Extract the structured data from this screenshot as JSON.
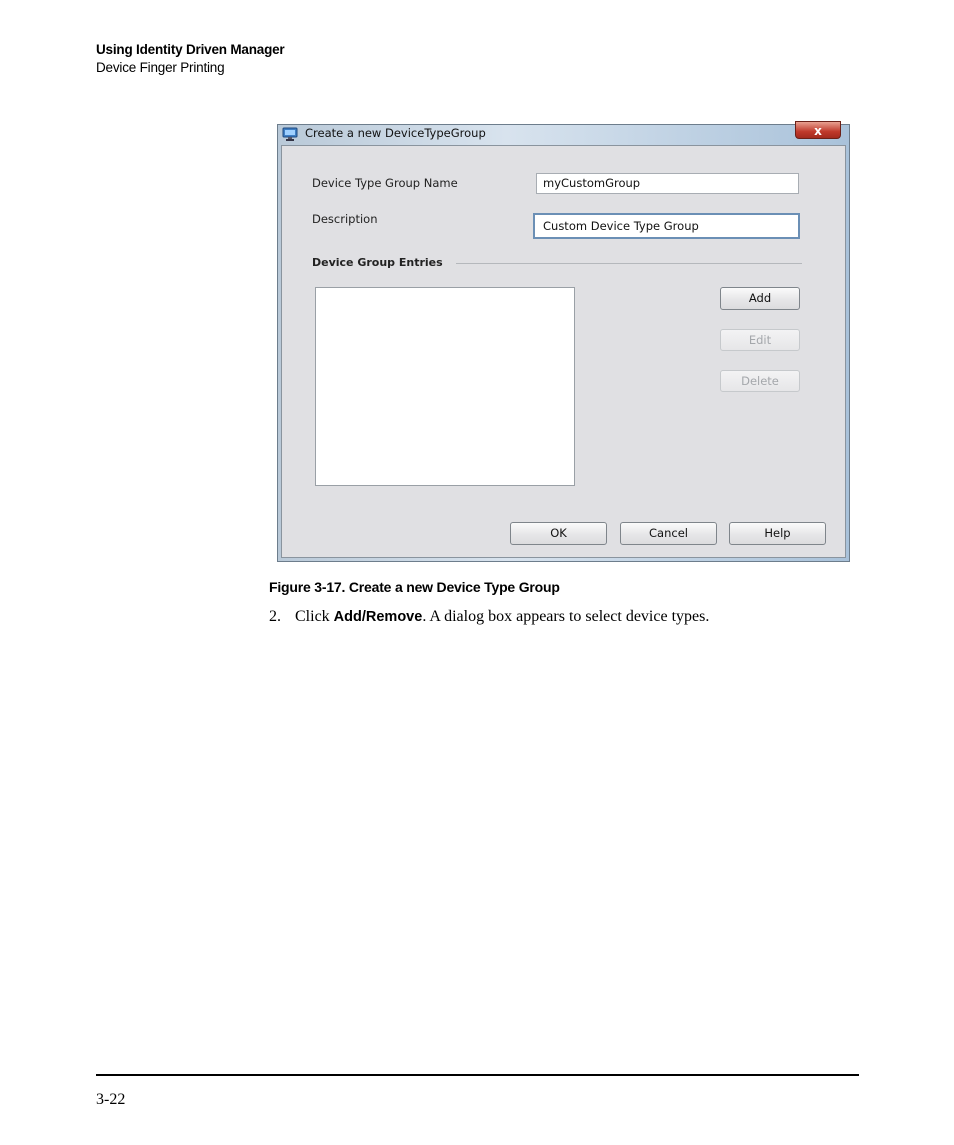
{
  "header": {
    "title": "Using Identity Driven Manager",
    "subtitle": "Device Finger Printing"
  },
  "dialog": {
    "title": "Create a new DeviceTypeGroup",
    "close_label": "x",
    "name_label": "Device Type Group Name",
    "name_value": "myCustomGroup",
    "description_label": "Description",
    "description_value": "Custom Device Type Group",
    "entries_label": "Device Group Entries",
    "add_label": "Add",
    "edit_label": "Edit",
    "delete_label": "Delete",
    "ok_label": "OK",
    "cancel_label": "Cancel",
    "help_label": "Help"
  },
  "figure_caption": "Figure 3-17. Create a new Device Type Group",
  "step": {
    "number": "2.",
    "prefix": "Click ",
    "keyword": "Add/Remove",
    "suffix": ". A dialog box appears to select device types."
  },
  "footer": {
    "page_number": "3-22"
  },
  "colors": {
    "dialog_frame": "#a9c2da",
    "client_background": "#e0e0e3",
    "focus_border": "#6b8fb5",
    "close_button": "#c0392b"
  }
}
